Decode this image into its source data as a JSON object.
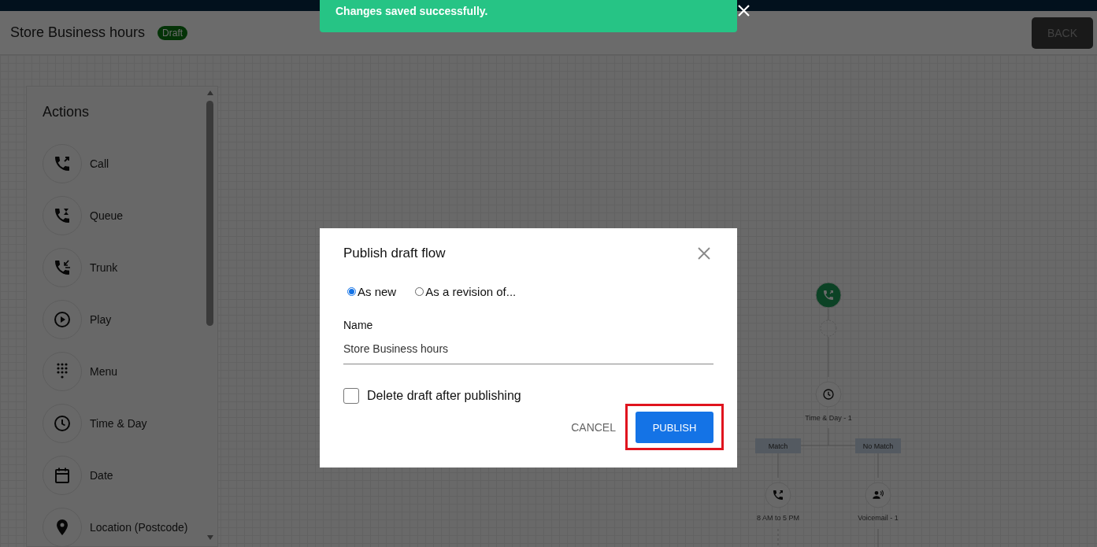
{
  "toast": {
    "message": "Changes saved successfully."
  },
  "header": {
    "title": "Store Business hours",
    "badge": "Draft",
    "back_button": "BACK"
  },
  "actions_panel": {
    "title": "Actions",
    "items": [
      {
        "label": "Call",
        "kind": "call"
      },
      {
        "label": "Queue",
        "kind": "queue"
      },
      {
        "label": "Trunk",
        "kind": "trunk"
      },
      {
        "label": "Play",
        "kind": "play"
      },
      {
        "label": "Menu",
        "kind": "menu"
      },
      {
        "label": "Time & Day",
        "kind": "clock"
      },
      {
        "label": "Date",
        "kind": "date"
      },
      {
        "label": "Location (Postcode)",
        "kind": "location"
      }
    ]
  },
  "flow": {
    "condition": {
      "label": "Time & Day - 1",
      "kind": "clock"
    },
    "branches": [
      {
        "label": "Match",
        "node": {
          "label": "8 AM to 5 PM",
          "kind": "call"
        }
      },
      {
        "label": "No Match",
        "node": {
          "label": "Voicemail - 1",
          "kind": "voicemail"
        }
      }
    ]
  },
  "dialog": {
    "title": "Publish draft flow",
    "options": [
      {
        "label": "As new",
        "selected": true
      },
      {
        "label": "As a revision of...",
        "selected": false
      }
    ],
    "name_label": "Name",
    "name_value": "Store Business hours",
    "delete_draft": {
      "label": "Delete draft after publishing",
      "checked": false
    },
    "cancel_button": "CANCEL",
    "publish_button": {
      "label": "PUBLISH",
      "highlighted": true
    }
  }
}
